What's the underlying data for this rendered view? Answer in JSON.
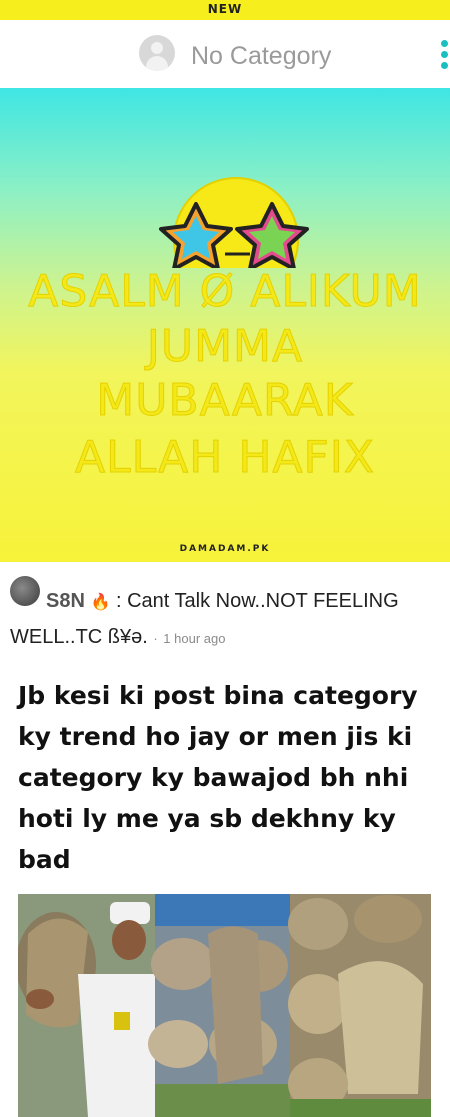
{
  "top_banner": {
    "label": "NEW"
  },
  "header": {
    "title": "No Category",
    "avatar_icon": "user-avatar-icon",
    "menu_icon": "kebab-menu-icon"
  },
  "post": {
    "greeting_lines": [
      "ASALM Ø ALIKUM",
      "JUMMA",
      "MUBAARAK",
      "ALLAH HAFIX"
    ],
    "watermark": "DAMADAM.PK",
    "emoji": "star-sunglasses-smiley"
  },
  "comment": {
    "username": "S8N",
    "badge": "🔥",
    "separator": ":",
    "text": "Cant Talk Now..NOT FEELING WELL..TC ß¥ə.",
    "time_separator": "·",
    "time": "1 hour ago"
  },
  "caption": "Jb kesi ki post bina category ky trend ho jay or men jis ki category ky bawajod bh nhi hoti ly me ya sb dekhny ky bad",
  "colors": {
    "banner_yellow": "#f6ee1d",
    "accent_teal": "#1abfc0",
    "gradient_top": "#3fe6e4",
    "gradient_bottom": "#f7f239"
  }
}
